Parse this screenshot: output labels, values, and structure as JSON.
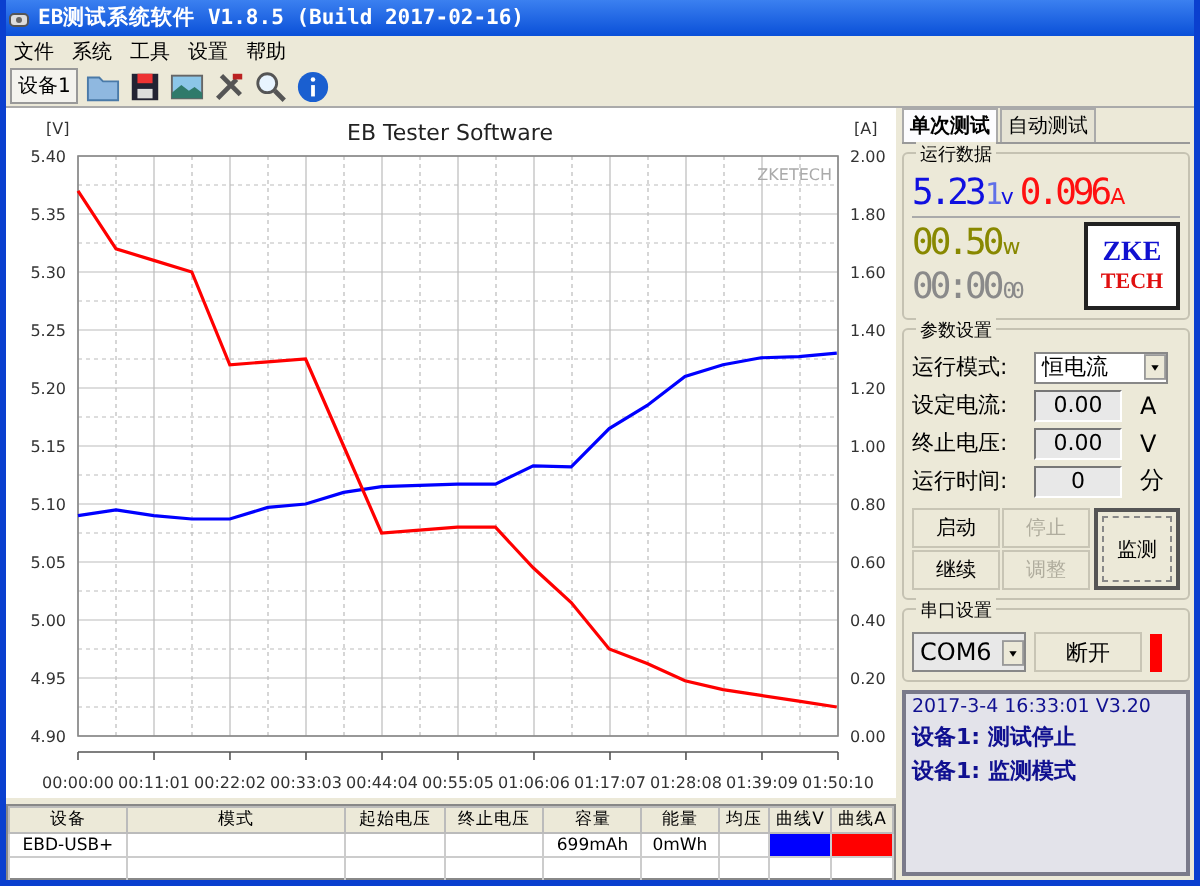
{
  "window": {
    "title": "EB测试系统软件 V1.8.5 (Build 2017-02-16)"
  },
  "menu": [
    "文件",
    "系统",
    "工具",
    "设置",
    "帮助"
  ],
  "toolbar": {
    "device_tab": "设备1"
  },
  "chart": {
    "brand_text": "ZKETECH",
    "chart_data": {
      "type": "line",
      "title": "EB Tester Software",
      "ylabel": "[V]",
      "y2label": "[A]",
      "x": [
        0,
        5.5,
        11,
        16.5,
        22,
        27.5,
        33,
        38.5,
        44,
        49.5,
        55,
        60.5,
        66,
        71.5,
        77,
        82.5,
        88,
        93.5,
        99,
        104.5,
        110
      ],
      "series": [
        {
          "color": "#0000ff",
          "values": [
            5.09,
            5.095,
            5.09,
            5.087,
            5.087,
            5.097,
            5.1,
            5.11,
            5.115,
            5.116,
            5.117,
            5.117,
            5.133,
            5.132,
            5.165,
            5.185,
            5.21,
            5.22,
            5.226,
            5.227,
            5.23
          ]
        },
        {
          "color": "#ff0000",
          "axis": "y2",
          "values": [
            1.88,
            1.68,
            1.64,
            1.6,
            1.28,
            1.29,
            1.3,
            1.0,
            0.7,
            0.71,
            0.72,
            0.72,
            0.58,
            0.46,
            0.3,
            0.25,
            0.19,
            0.16,
            0.14,
            0.12,
            0.1
          ]
        }
      ],
      "grid": true,
      "xlim": [
        0,
        110.17
      ],
      "ylim": [
        4.9,
        5.4
      ],
      "y2lim": [
        0,
        2
      ],
      "xticks": [
        {
          "value": 0,
          "label": "00:00:00"
        },
        {
          "value": 11.02,
          "label": "00:11:01"
        },
        {
          "value": 22.03,
          "label": "00:22:02"
        },
        {
          "value": 33.05,
          "label": "00:33:03"
        },
        {
          "value": 44.07,
          "label": "00:44:04"
        },
        {
          "value": 55.08,
          "label": "00:55:05"
        },
        {
          "value": 66.1,
          "label": "01:06:06"
        },
        {
          "value": 77.12,
          "label": "01:17:07"
        },
        {
          "value": 88.13,
          "label": "01:28:08"
        },
        {
          "value": 99.15,
          "label": "01:39:09"
        },
        {
          "value": 110.17,
          "label": "01:50:10"
        }
      ],
      "yticks": [
        {
          "value": 4.9,
          "label": "4.90"
        },
        {
          "value": 4.95,
          "label": "4.95"
        },
        {
          "value": 5.0,
          "label": "5.00"
        },
        {
          "value": 5.05,
          "label": "5.05"
        },
        {
          "value": 5.1,
          "label": "5.10"
        },
        {
          "value": 5.15,
          "label": "5.15"
        },
        {
          "value": 5.2,
          "label": "5.20"
        },
        {
          "value": 5.25,
          "label": "5.25"
        },
        {
          "value": 5.3,
          "label": "5.30"
        },
        {
          "value": 5.35,
          "label": "5.35"
        },
        {
          "value": 5.4,
          "label": "5.40"
        }
      ],
      "y2ticks": [
        {
          "value": 0,
          "label": "0.00"
        },
        {
          "value": 0.2,
          "label": "0.20"
        },
        {
          "value": 0.4,
          "label": "0.40"
        },
        {
          "value": 0.6,
          "label": "0.60"
        },
        {
          "value": 0.8,
          "label": "0.80"
        },
        {
          "value": 1.0,
          "label": "1.00"
        },
        {
          "value": 1.2,
          "label": "1.20"
        },
        {
          "value": 1.4,
          "label": "1.40"
        },
        {
          "value": 1.6,
          "label": "1.60"
        },
        {
          "value": 1.8,
          "label": "1.80"
        },
        {
          "value": 2.0,
          "label": "2.00"
        }
      ]
    }
  },
  "table": {
    "columns": [
      "设备",
      "模式",
      "起始电压",
      "终止电压",
      "容量",
      "能量",
      "均压",
      "曲线V",
      "曲线A"
    ],
    "rows": [
      {
        "cells": [
          {
            "text": "EBD-USB+"
          },
          {},
          {},
          {},
          {
            "text": "699mAh"
          },
          {
            "text": "0mWh"
          },
          {},
          {
            "color": "#0000ff"
          },
          {
            "color": "#ff0000"
          }
        ]
      },
      {
        "cells": [
          {},
          {},
          {},
          {},
          {},
          {},
          {},
          {},
          {}
        ]
      }
    ]
  },
  "panel": {
    "tabs": [
      {
        "label": "单次测试",
        "selected": true
      },
      {
        "label": "自动测试",
        "selected": false
      }
    ],
    "run_data": {
      "title": "运行数据",
      "voltage": "5.23",
      "voltage_digit": "1",
      "voltage_unit": "v",
      "current": "0.096",
      "current_unit": "A",
      "power": "00.50",
      "power_unit": "w",
      "time": "00:00",
      "time_seconds": "00",
      "logo_top": "ZKE",
      "logo_bottom": "TECH"
    },
    "params": {
      "title": "参数设置",
      "rows": [
        {
          "kind": "select",
          "label": "运行模式:",
          "value": "恒电流"
        },
        {
          "kind": "field",
          "label": "设定电流:",
          "value": "0.00",
          "unit": "A"
        },
        {
          "kind": "field",
          "label": "终止电压:",
          "value": "0.00",
          "unit": "V"
        },
        {
          "kind": "field",
          "label": "运行时间:",
          "value": "0",
          "unit": "分"
        }
      ],
      "buttons": [
        {
          "label": "启动",
          "disabled": false
        },
        {
          "label": "停止",
          "disabled": true
        },
        {
          "label": "继续",
          "disabled": false
        },
        {
          "label": "调整",
          "disabled": true
        }
      ],
      "monitor_button": "监测"
    },
    "serial": {
      "title": "串口设置",
      "port": "COM6",
      "button": "断开"
    },
    "status": [
      "2017-3-4 16:33:01   V3.20",
      "设备1: 测试停止",
      "设备1: 监测模式"
    ]
  }
}
